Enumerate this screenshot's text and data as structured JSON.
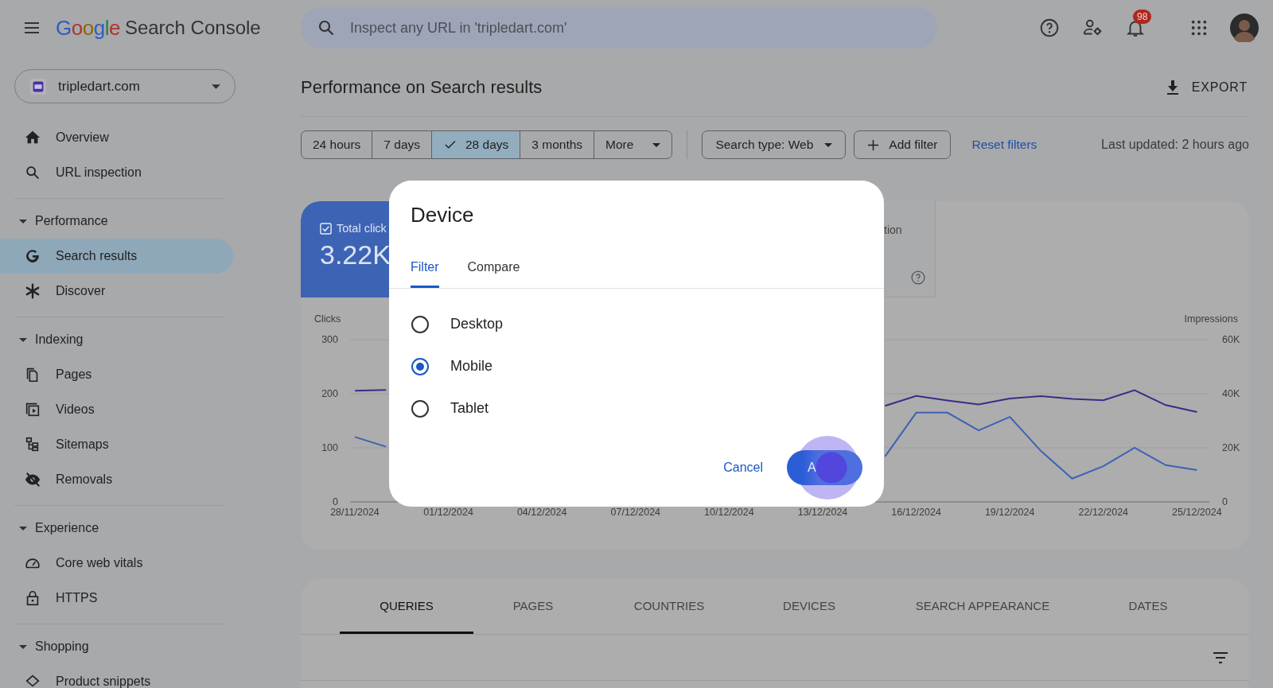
{
  "header": {
    "logo_brand": "Google",
    "logo_product": "Search Console",
    "search": {
      "placeholder": "Inspect any URL in 'tripledart.com'"
    },
    "notifications_badge": "98"
  },
  "property": {
    "name": "tripledart.com"
  },
  "sidebar": {
    "sections": [
      {
        "items": [
          {
            "label": "Overview",
            "kind": "home",
            "selected": false
          },
          {
            "label": "URL inspection",
            "kind": "search",
            "selected": false
          }
        ]
      },
      {
        "title": "Performance",
        "expanded": true,
        "items": [
          {
            "label": "Search results",
            "kind": "g",
            "selected": true
          },
          {
            "label": "Discover",
            "kind": "asterisk",
            "selected": false
          }
        ]
      },
      {
        "title": "Indexing",
        "expanded": true,
        "items": [
          {
            "label": "Pages",
            "kind": "pages",
            "selected": false
          },
          {
            "label": "Videos",
            "kind": "videos",
            "selected": false
          },
          {
            "label": "Sitemaps",
            "kind": "sitemap",
            "selected": false
          },
          {
            "label": "Removals",
            "kind": "eye-off",
            "selected": false
          }
        ]
      },
      {
        "title": "Experience",
        "expanded": true,
        "items": [
          {
            "label": "Core web vitals",
            "kind": "gauge",
            "selected": false
          },
          {
            "label": "HTTPS",
            "kind": "lock",
            "selected": false
          }
        ]
      },
      {
        "title": "Shopping",
        "expanded": true,
        "items": [
          {
            "label": "Product snippets",
            "kind": "diamond",
            "selected": false
          }
        ]
      }
    ]
  },
  "page": {
    "title": "Performance on Search results",
    "export": "EXPORT",
    "date_ranges": [
      {
        "label": "24 hours",
        "kind": "range",
        "selected": false
      },
      {
        "label": "7 days",
        "kind": "range",
        "selected": false
      },
      {
        "label": "28 days",
        "kind": "range",
        "selected": true
      },
      {
        "label": "3 months",
        "kind": "range",
        "selected": false
      },
      {
        "label": "More",
        "kind": "menu",
        "selected": false
      }
    ],
    "search_type": "Search type: Web",
    "add_filter": "Add filter",
    "reset_filters": "Reset filters",
    "last_updated": "Last updated: 2 hours ago",
    "metrics": [
      {
        "label": "Total click",
        "value": "3.22K",
        "selected": true
      },
      {
        "label": "tion",
        "selected": false
      }
    ],
    "performance_chart": {
      "clicks": {
        "chart_data": {
          "type": "line",
          "ylim": [
            0,
            300
          ],
          "yticks": [
            0,
            100,
            200,
            300
          ],
          "categories": [
            "28/11/2024",
            null,
            null,
            "01/12/2024",
            null,
            null,
            "04/12/2024",
            null,
            null,
            "07/12/2024",
            null,
            null,
            "10/12/2024",
            null,
            null,
            "13/12/2024",
            null,
            null,
            "16/12/2024",
            null,
            null,
            "19/12/2024",
            null,
            null,
            "22/12/2024",
            null,
            null,
            "25/12/2024"
          ],
          "series": [
            {
              "name": "Clicks",
              "color": "#3d62b3",
              "values": [
                120,
                102,
                null,
                null,
                null,
                null,
                null,
                null,
                null,
                null,
                null,
                null,
                null,
                null,
                null,
                null,
                null,
                84,
                165,
                165,
                132,
                157,
                94,
                43,
                66,
                100,
                68,
                59
              ]
            }
          ]
        }
      },
      "impressions": {
        "chart_data": {
          "type": "line",
          "ylim": [
            0,
            60000
          ],
          "yticks": [
            {
              "value": 0,
              "label": "0"
            },
            {
              "value": 20000,
              "label": "20K"
            },
            {
              "value": 40000,
              "label": "40K"
            },
            {
              "value": 60000,
              "label": "60K"
            }
          ],
          "series": [
            {
              "name": "Impressions",
              "color": "#3f2a86",
              "values": [
                41100,
                41400,
                null,
                null,
                null,
                null,
                null,
                null,
                null,
                null,
                null,
                null,
                null,
                null,
                null,
                null,
                null,
                35500,
                39200,
                37500,
                36000,
                38200,
                39100,
                38100,
                37600,
                41300,
                35800,
                33200
              ]
            }
          ]
        }
      }
    },
    "bottom_tabs": [
      {
        "label": "QUERIES",
        "selected": true
      },
      {
        "label": "PAGES",
        "selected": false
      },
      {
        "label": "COUNTRIES",
        "selected": false
      },
      {
        "label": "DEVICES",
        "selected": false
      },
      {
        "label": "SEARCH APPEARANCE",
        "selected": false
      },
      {
        "label": "DATES",
        "selected": false
      }
    ]
  },
  "dialog": {
    "title": "Device",
    "tabs": [
      {
        "label": "Filter",
        "selected": true
      },
      {
        "label": "Compare",
        "selected": false
      }
    ],
    "options": [
      {
        "label": "Desktop",
        "selected": false
      },
      {
        "label": "Mobile",
        "selected": true
      },
      {
        "label": "Tablet",
        "selected": false
      }
    ],
    "cancel": "Cancel",
    "apply": "A"
  }
}
